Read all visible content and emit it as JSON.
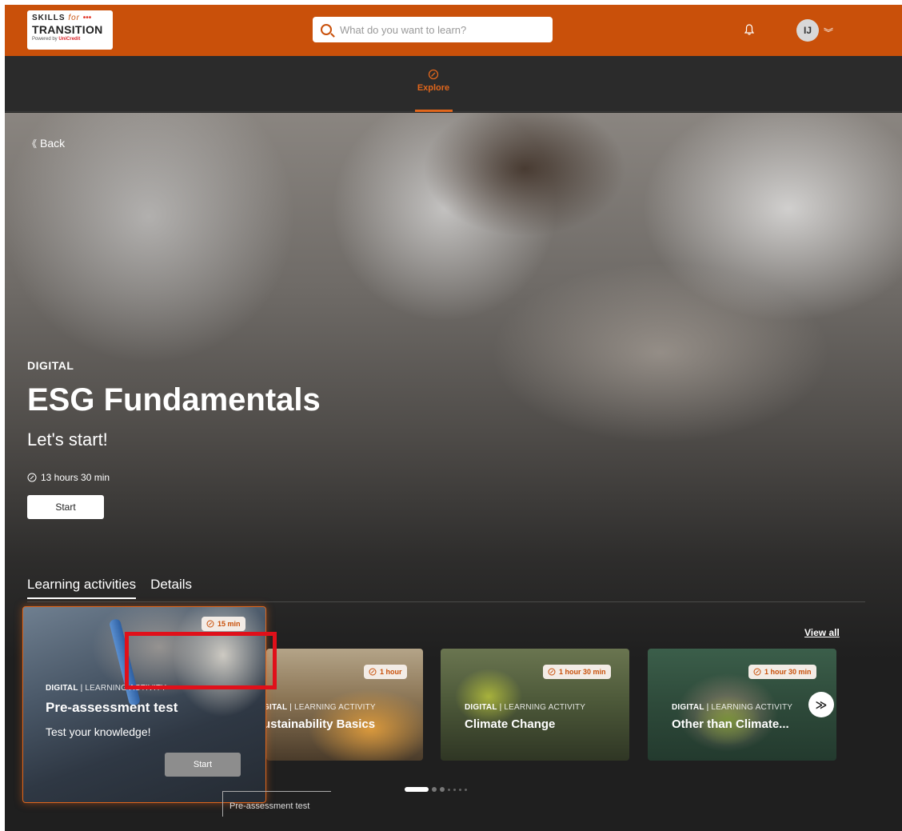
{
  "header": {
    "logo": {
      "line1": "SKILLS",
      "line1_for": "for",
      "line1_dots": "•••",
      "line2": "TRANSITION",
      "line3": "Powered by",
      "line3_brand": "UniCredit"
    },
    "search_placeholder": "What do you want to learn?",
    "avatar_initials": "IJ",
    "brand_color": "#c9500a"
  },
  "subnav": {
    "explore_label": "Explore"
  },
  "hero": {
    "back_label": "Back",
    "category": "DIGITAL",
    "title": "ESG Fundamentals",
    "subtitle": "Let's start!",
    "duration": "13 hours 30 min",
    "start_label": "Start"
  },
  "tabs": [
    {
      "label": "Learning activities",
      "active": true
    },
    {
      "label": "Details",
      "active": false
    }
  ],
  "view_all_label": "View all",
  "cards": [
    {
      "duration": "15 min",
      "category": "DIGITAL",
      "type": "LEARNING ACTIVITY",
      "title": "Pre-assessment test",
      "description": "Test your knowledge!",
      "start_label": "Start"
    },
    {
      "duration": "1 hour",
      "category": "GITAL",
      "type": "LEARNING ACTIVITY",
      "title": "ustainability Basics"
    },
    {
      "duration": "1 hour 30 min",
      "category": "DIGITAL",
      "type": "LEARNING ACTIVITY",
      "title": "Climate Change"
    },
    {
      "duration": "1 hour 30 min",
      "category": "DIGITAL",
      "type": "LEARNING ACTIVITY",
      "title": "Other than Climate..."
    }
  ],
  "tooltip_text": "Pre-assessment test",
  "pagination": {
    "active_index": 0
  }
}
